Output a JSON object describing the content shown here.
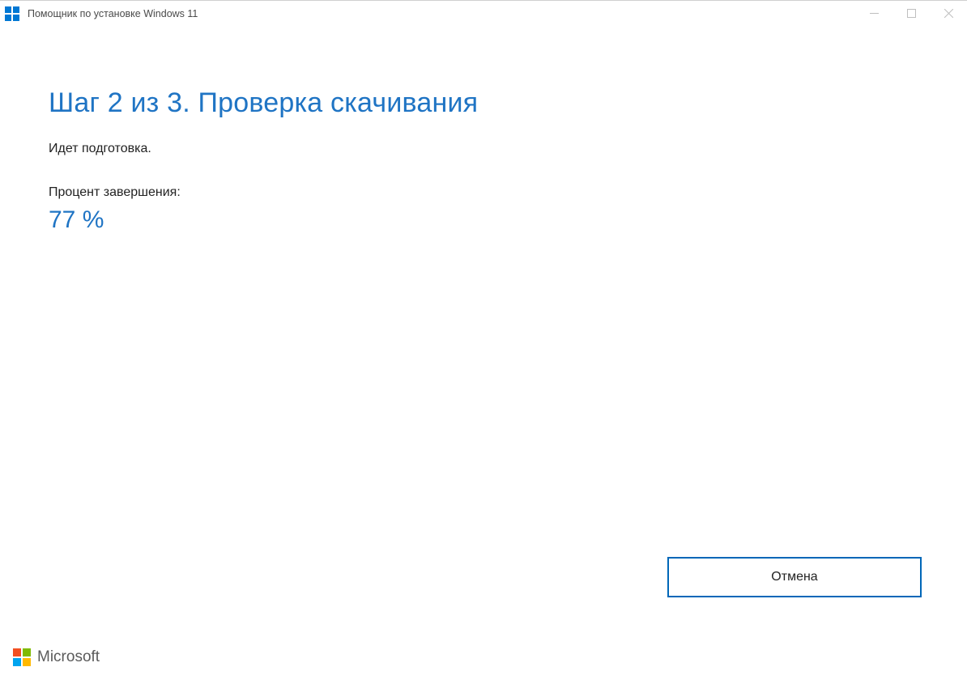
{
  "window": {
    "title": "Помощник по установке Windows 11"
  },
  "main": {
    "heading": "Шаг 2 из 3. Проверка скачивания",
    "status": "Идет подготовка.",
    "progress_label": "Процент завершения:",
    "progress_value": "77 %"
  },
  "actions": {
    "cancel": "Отмена"
  },
  "footer": {
    "brand": "Microsoft"
  },
  "colors": {
    "accent": "#0078d4",
    "heading": "#1f74c4",
    "button_border": "#0067b8"
  }
}
